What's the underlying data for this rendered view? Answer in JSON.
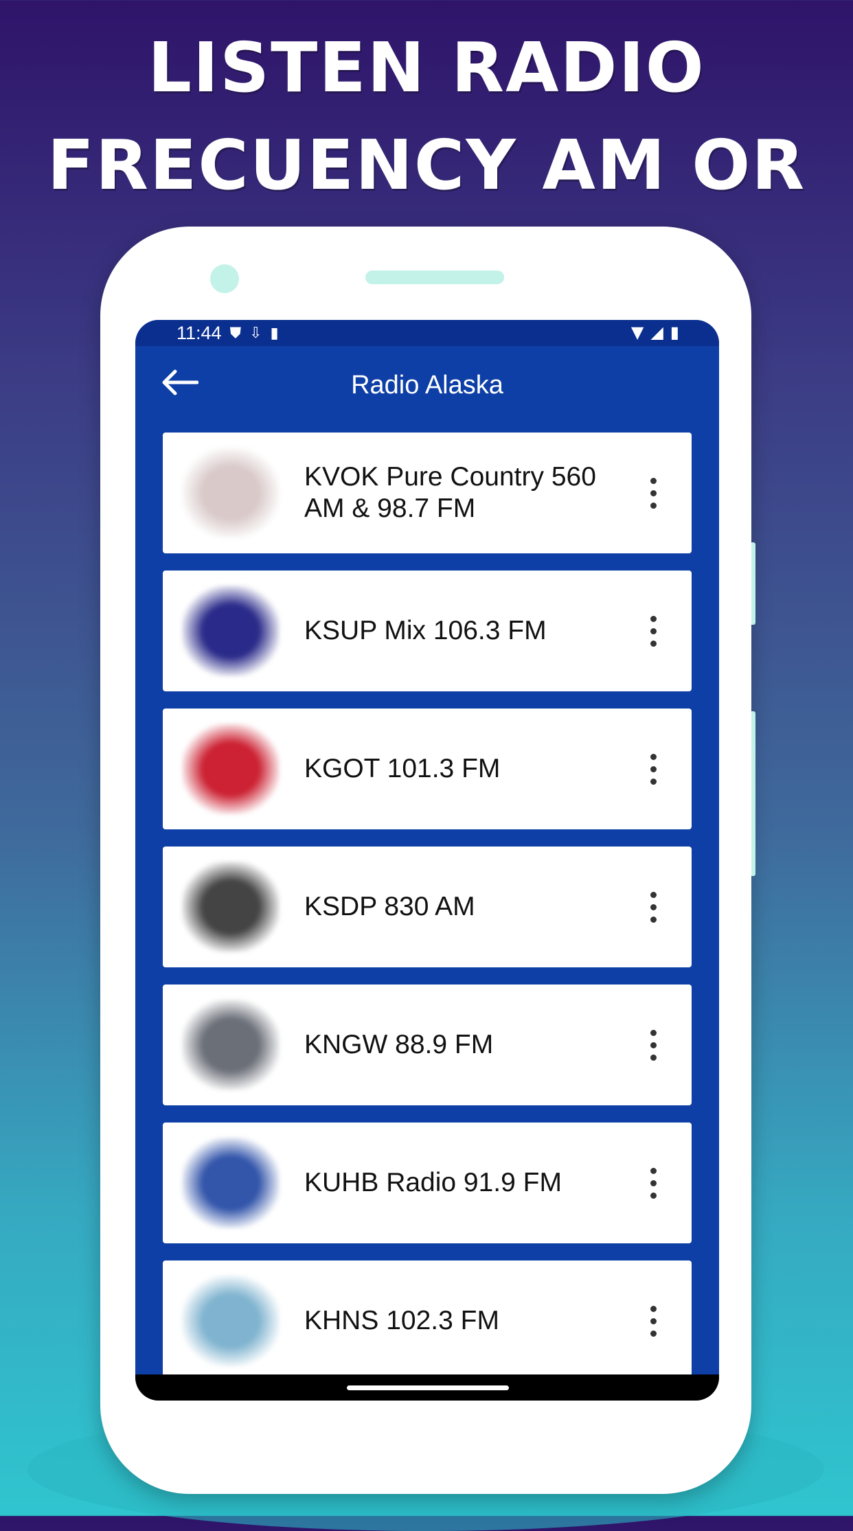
{
  "headline": {
    "line1": "LISTEN RADIO",
    "line2": "FRECUENCY AM OR FM"
  },
  "status": {
    "time": "11:44"
  },
  "appbar": {
    "title": "Radio Alaska",
    "back_icon": "arrow-left-icon"
  },
  "stations": [
    {
      "name": "KVOK Pure Country 560 AM & 98.7 FM",
      "logo_color": "#d9c9c9"
    },
    {
      "name": "KSUP Mix 106.3 FM",
      "logo_color": "#2a2a8a"
    },
    {
      "name": "KGOT 101.3 FM",
      "logo_color": "#cc2233"
    },
    {
      "name": "KSDP 830 AM",
      "logo_color": "#444444"
    },
    {
      "name": "KNGW 88.9 FM",
      "logo_color": "#6b6f78"
    },
    {
      "name": "KUHB Radio 91.9 FM",
      "logo_color": "#3355aa"
    },
    {
      "name": "KHNS 102.3 FM",
      "logo_color": "#7fb3cf"
    }
  ],
  "colors": {
    "appbar": "#0d3fa6",
    "statusbar": "#0a2f8f",
    "accent": "#c3f2e8"
  }
}
